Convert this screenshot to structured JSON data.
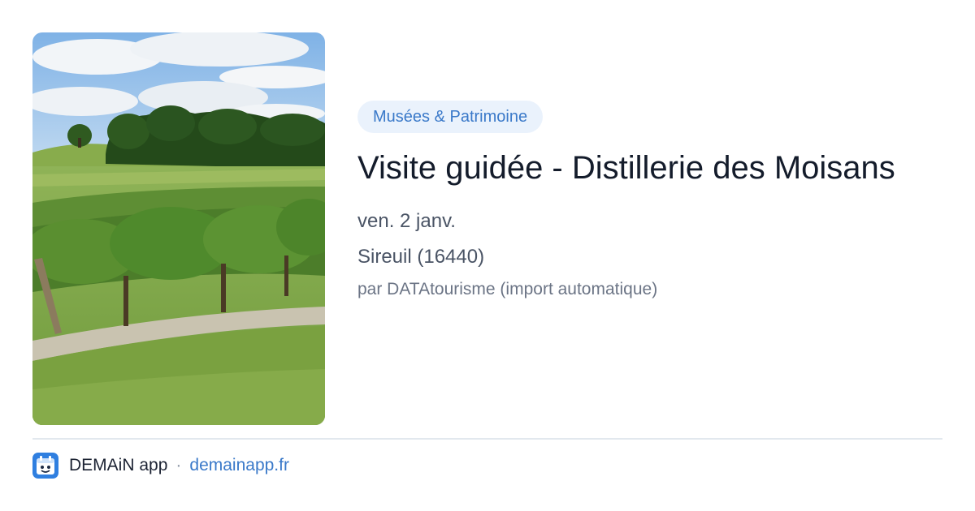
{
  "card": {
    "category": "Musées & Patrimoine",
    "title": "Visite guidée - Distillerie des Moisans",
    "date": "ven. 2 janv.",
    "location": "Sireuil (16440)",
    "source": "par DATAtourisme (import automatique)"
  },
  "footer": {
    "app_name": "DEMAiN app",
    "separator": "·",
    "domain": "demainapp.fr"
  },
  "icons": {
    "app": "demain-app-icon"
  },
  "colors": {
    "accent": "#3a79c9",
    "badge_background": "#eaf2fc",
    "title": "#141c2b",
    "meta": "#4a5465",
    "muted": "#6b7485",
    "divider": "#e2e8ee"
  }
}
